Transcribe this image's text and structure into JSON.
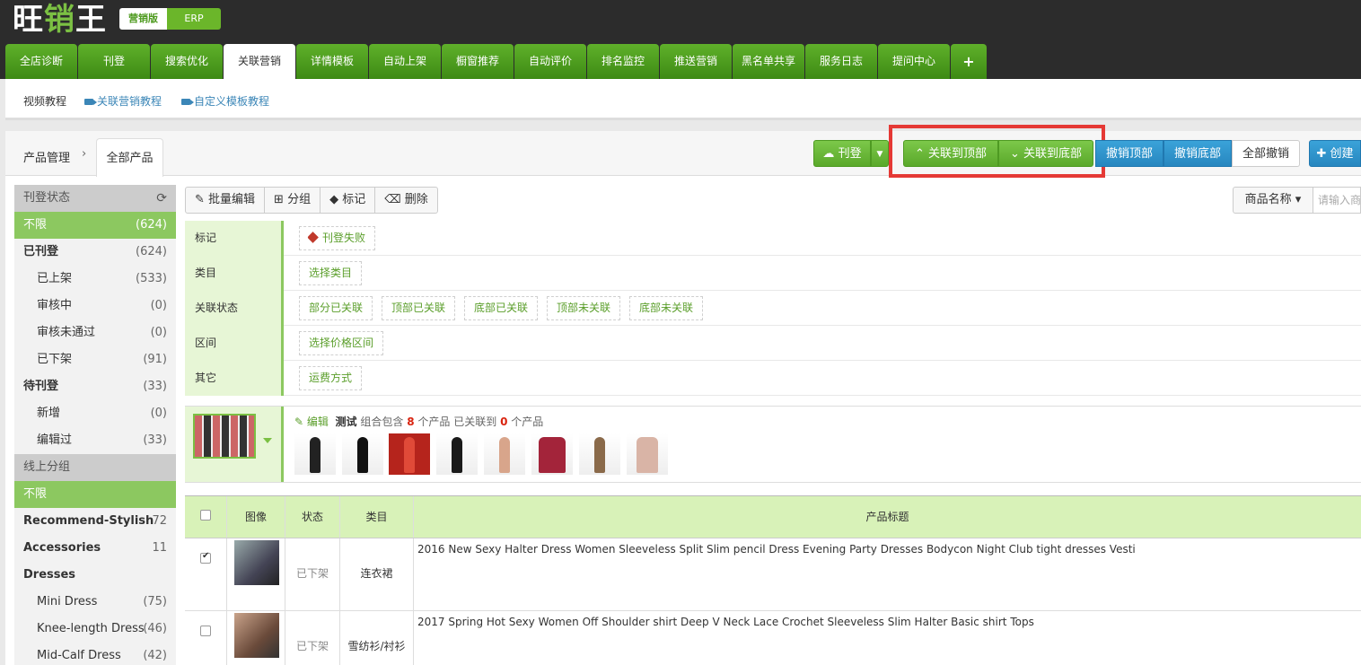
{
  "app": {
    "logo_a": "旺",
    "logo_b": "销",
    "logo_c": "王",
    "version_active": "营销版",
    "version_other": "ERP"
  },
  "tabs": [
    "全店诊断",
    "刊登",
    "搜索优化",
    "关联营销",
    "详情模板",
    "自动上架",
    "橱窗推荐",
    "自动评价",
    "排名监控",
    "推送营销",
    "黑名单共享",
    "服务日志",
    "提问中心"
  ],
  "tab_plus": "+",
  "subnav": {
    "video": "视频教程",
    "link1": "关联营销教程",
    "link2": "自定义模板教程"
  },
  "breadcrumb": {
    "parent": "产品管理",
    "separator": "›",
    "current": "全部产品"
  },
  "actions": {
    "publish": "刊登",
    "to_top": "关联到顶部",
    "to_bottom": "关联到底部",
    "cancel_top": "撤销顶部",
    "cancel_bottom": "撤销底部",
    "cancel_all": "全部撤销",
    "create": "创建"
  },
  "toolbar": {
    "batch_edit": "批量编辑",
    "group": "分组",
    "tag": "标记",
    "delete": "删除"
  },
  "search": {
    "field": "商品名称",
    "placeholder": "请输入商"
  },
  "sidebar": {
    "status_title": "刊登状态",
    "status_items": [
      {
        "label": "不限",
        "count": "(624)"
      },
      {
        "label": "已刊登",
        "count": "(624)"
      },
      {
        "label": "已上架",
        "count": "(533)"
      },
      {
        "label": "审核中",
        "count": "(0)"
      },
      {
        "label": "审核未通过",
        "count": "(0)"
      },
      {
        "label": "已下架",
        "count": "(91)"
      },
      {
        "label": "待刊登",
        "count": "(33)"
      },
      {
        "label": "新增",
        "count": "(0)"
      },
      {
        "label": "编辑过",
        "count": "(33)"
      }
    ],
    "group_title": "线上分组",
    "group_items": [
      {
        "label": "不限",
        "count": ""
      },
      {
        "label": "Recommend-Stylish",
        "count": "72"
      },
      {
        "label": "Accessories",
        "count": "11"
      },
      {
        "label": "Dresses",
        "count": ""
      },
      {
        "label": "Mini Dress",
        "count": "(75)"
      },
      {
        "label": "Knee-length Dress",
        "count": "(46)"
      },
      {
        "label": "Mid-Calf Dress",
        "count": "(42)"
      }
    ]
  },
  "filters": {
    "mark": {
      "label": "标记",
      "chips": [
        "刊登失败"
      ]
    },
    "category": {
      "label": "类目",
      "chips": [
        "选择类目"
      ]
    },
    "relation": {
      "label": "关联状态",
      "chips": [
        "部分已关联",
        "顶部已关联",
        "底部已关联",
        "顶部未关联",
        "底部未关联"
      ]
    },
    "range": {
      "label": "区间",
      "chips": [
        "选择价格区间"
      ]
    },
    "other": {
      "label": "其它",
      "chips": [
        "运费方式"
      ]
    }
  },
  "group": {
    "edit": "编辑",
    "name": "测试",
    "text1": "组合包含",
    "count": "8",
    "text2": "个产品 已关联到",
    "linked": "0",
    "text3": "个产品"
  },
  "table": {
    "headers": {
      "image": "图像",
      "status": "状态",
      "category": "类目",
      "title": "产品标题"
    },
    "rows": [
      {
        "status": "已下架",
        "category": "连衣裙",
        "title": "2016 New Sexy Halter Dress Women Sleeveless Split Slim pencil Dress Evening Party Dresses Bodycon Night Club tight dresses Vesti",
        "checked": true
      },
      {
        "status": "已下架",
        "category": "雪纺衫/衬衫",
        "title": "2017 Spring Hot Sexy Women Off Shoulder shirt Deep V Neck Lace Crochet Sleeveless Slim Halter Basic shirt Tops",
        "checked": false
      }
    ]
  },
  "colors": {
    "brand_green": "#5fb02a",
    "accent_blue": "#2787bf",
    "highlight_red": "#e53935"
  }
}
